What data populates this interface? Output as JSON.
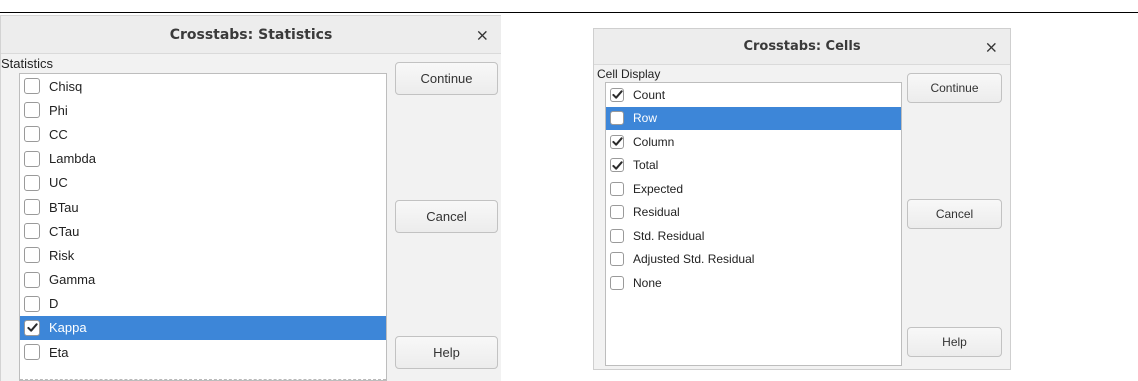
{
  "statistics_dialog": {
    "title": "Crosstabs: Statistics",
    "group_label": "Statistics",
    "items": [
      {
        "label": "Chisq",
        "checked": false,
        "selected": false
      },
      {
        "label": "Phi",
        "checked": false,
        "selected": false
      },
      {
        "label": "CC",
        "checked": false,
        "selected": false
      },
      {
        "label": "Lambda",
        "checked": false,
        "selected": false
      },
      {
        "label": "UC",
        "checked": false,
        "selected": false
      },
      {
        "label": "BTau",
        "checked": false,
        "selected": false
      },
      {
        "label": "CTau",
        "checked": false,
        "selected": false
      },
      {
        "label": "Risk",
        "checked": false,
        "selected": false
      },
      {
        "label": "Gamma",
        "checked": false,
        "selected": false
      },
      {
        "label": "D",
        "checked": false,
        "selected": false
      },
      {
        "label": "Kappa",
        "checked": true,
        "selected": true
      },
      {
        "label": "Eta",
        "checked": false,
        "selected": false
      }
    ],
    "buttons": {
      "continue": "Continue",
      "cancel": "Cancel",
      "help": "Help"
    },
    "close_glyph": "×"
  },
  "cells_dialog": {
    "title": "Crosstabs: Cells",
    "group_label": "Cell Display",
    "items": [
      {
        "label": "Count",
        "checked": true,
        "selected": false
      },
      {
        "label": "Row",
        "checked": false,
        "selected": true
      },
      {
        "label": "Column",
        "checked": true,
        "selected": false
      },
      {
        "label": "Total",
        "checked": true,
        "selected": false
      },
      {
        "label": "Expected",
        "checked": false,
        "selected": false
      },
      {
        "label": "Residual",
        "checked": false,
        "selected": false
      },
      {
        "label": "Std. Residual",
        "checked": false,
        "selected": false
      },
      {
        "label": "Adjusted Std. Residual",
        "checked": false,
        "selected": false
      },
      {
        "label": "None",
        "checked": false,
        "selected": false
      }
    ],
    "buttons": {
      "continue": "Continue",
      "cancel": "Cancel",
      "help": "Help"
    },
    "close_glyph": "×"
  },
  "colors": {
    "selection": "#3d86d8",
    "dialog_bg": "#f2f2f2"
  }
}
